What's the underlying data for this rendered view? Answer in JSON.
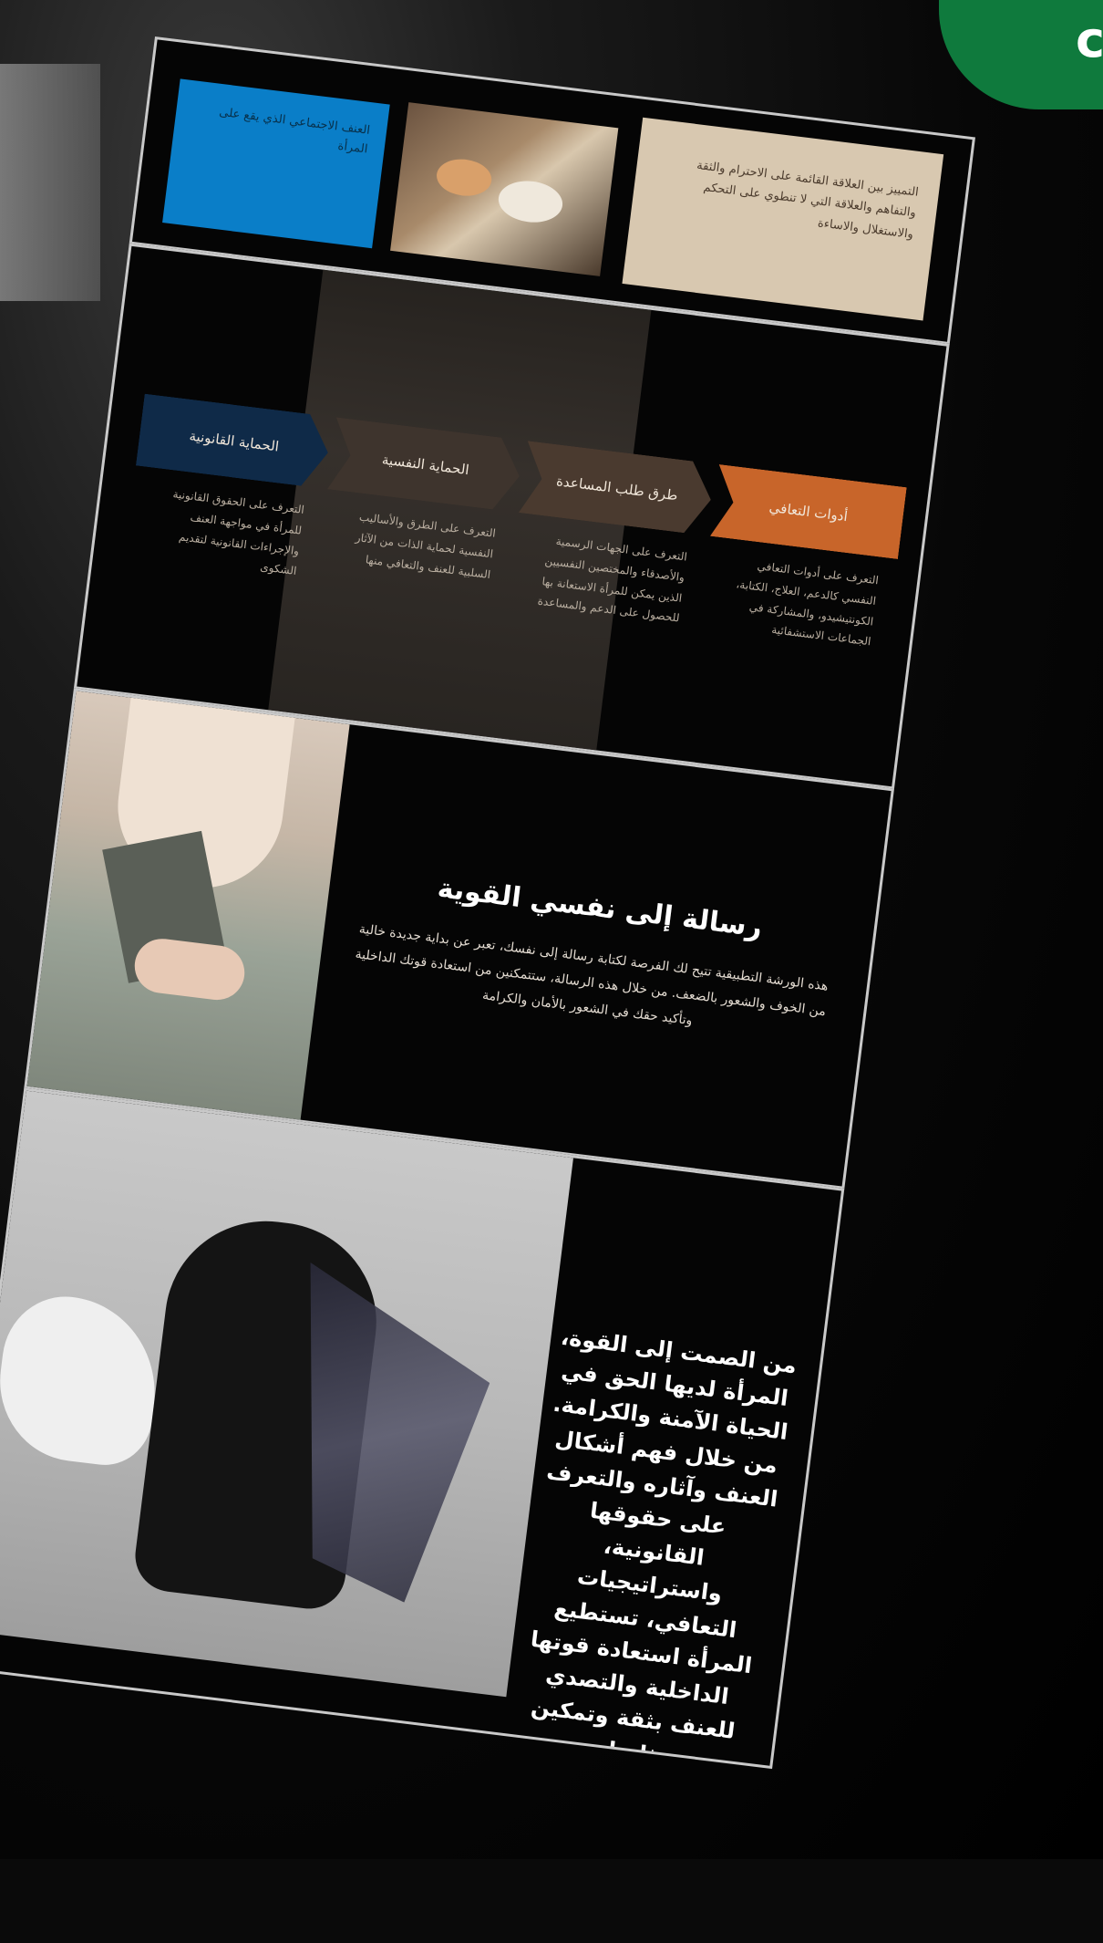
{
  "badge": {
    "letter": "c"
  },
  "panel1": {
    "blue_card_text": "العنف الاجتماعي الذي يقع على المرأة",
    "beige_card_text": "التمييز بين العلاقة القائمة على الاحترام والثقة والتفاهم والعلاقة التي لا تنطوي على التحكم والاستغلال والاساءة"
  },
  "panel2": {
    "steps": [
      {
        "label": "أدوات التعافي",
        "desc": "التعرف على أدوات التعافي النفسي كالدعم، العلاج، الكتابة، الكونتيشيدو، والمشاركة في الجماعات الاستشفائية"
      },
      {
        "label": "طرق طلب المساعدة",
        "desc": "التعرف على الجهات الرسمية والأصدقاء والمختصين النفسيين الذين يمكن للمرأة الاستعانة بها للحصول على الدعم والمساعدة"
      },
      {
        "label": "الحماية النفسية",
        "desc": "التعرف على الطرق والأساليب النفسية لحماية الذات من الآثار السلبية للعنف والتعافي منها"
      },
      {
        "label": "الحماية القانونية",
        "desc": "التعرف على الحقوق القانونية للمرأة في مواجهة العنف والإجراءات القانونية لتقديم الشكوى"
      }
    ]
  },
  "panel3": {
    "title": "رسالة إلى نفسي القوية",
    "body": "هذه الورشة التطبيقية تتيح لك الفرصة لكتابة رسالة إلى نفسك، تعبر عن بداية جديدة خالية من الخوف والشعور بالضعف. من خلال هذه الرسالة، ستتمكنين من استعادة قوتك الداخلية وتأكيد حقك في الشعور بالأمان والكرامة"
  },
  "panel4": {
    "text": "من الصمت إلى القوة، المرأة لديها الحق في الحياة الآمنة والكرامة. من خلال فهم أشكال العنف وآثاره والتعرف على حقوقها القانونية، واستراتيجيات التعافي، تستطيع المرأة استعادة قوتها الداخلية والتصدي للعنف بثقة وتمكين ذاتها."
  },
  "colors": {
    "orange_step": "#c8652a",
    "navy_step": "#0f2a48",
    "blue_card": "#0a7ec8",
    "beige_card": "#d8c8b0",
    "badge_green": "#0f7a3d"
  }
}
